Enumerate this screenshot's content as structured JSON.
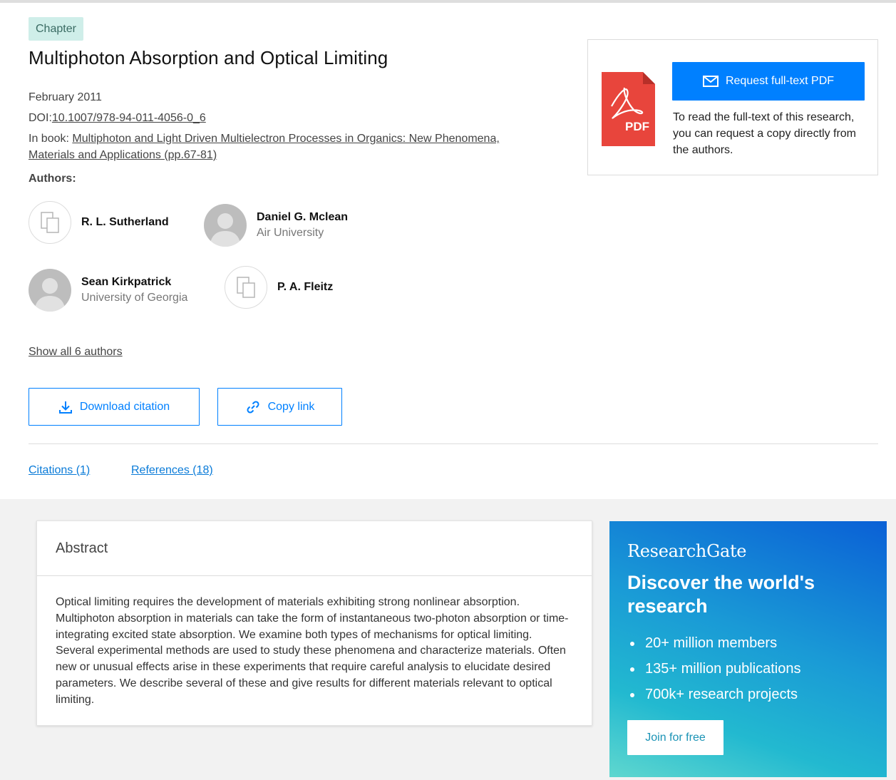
{
  "badge": "Chapter",
  "title": "Multiphoton Absorption and Optical Limiting",
  "date": "February 2011",
  "doi": {
    "label": "DOI:",
    "value": "10.1007/978-94-011-4056-0_6"
  },
  "in_book": {
    "label": "In book: ",
    "title_line1": "Multiphoton and Light Driven Multielectron Processes in Organics: New Phenomena,",
    "title_line2": "Materials and Applications (pp.67-81)"
  },
  "authors_label": "Authors:",
  "authors": [
    {
      "name": "R. L. Sutherland",
      "institution": "",
      "avatar": "placeholder"
    },
    {
      "name": "Daniel G. Mclean",
      "institution": "Air University",
      "avatar": "photo"
    },
    {
      "name": "Sean Kirkpatrick",
      "institution": "University of Georgia",
      "avatar": "photo"
    },
    {
      "name": "P. A. Fleitz",
      "institution": "",
      "avatar": "placeholder"
    }
  ],
  "show_all_authors": "Show all 6 authors",
  "actions": {
    "download_citation": "Download citation",
    "copy_link": "Copy link"
  },
  "tabs": {
    "citations": "Citations (1)",
    "references": "References (18)"
  },
  "pdf_card": {
    "icon_text": "PDF",
    "request_button": "Request full-text PDF",
    "note": "To read the full-text of this research, you can request a copy directly from the authors."
  },
  "abstract": {
    "heading": "Abstract",
    "body": "Optical limiting requires the development of materials exhibiting strong nonlinear absorption. Multiphoton absorption in materials can take the form of instantaneous two-photon absorption or time-integrating excited state absorption. We examine both types of mechanisms for optical limiting. Several experimental methods are used to study these phenomena and characterize materials. Often new or unusual effects arise in these experiments that require careful analysis to elucidate desired parameters. We describe several of these and give results for different materials relevant to optical limiting."
  },
  "promo": {
    "logo": "ResearchGate",
    "headline": "Discover the world's research",
    "bullets": [
      "20+ million members",
      "135+ million publications",
      "700k+ research projects"
    ],
    "join_button": "Join for free"
  },
  "colors": {
    "accent": "#0080ff",
    "badge_bg": "#cfeee9",
    "pdf_red": "#e8453c",
    "band_bg": "#f2f2f2"
  }
}
